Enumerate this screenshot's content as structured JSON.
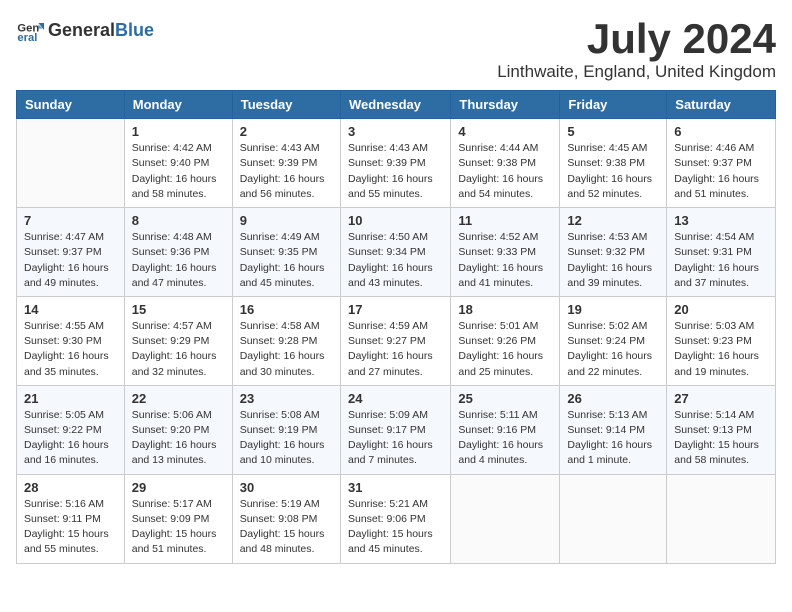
{
  "logo": {
    "text_general": "General",
    "text_blue": "Blue"
  },
  "title": {
    "month": "July 2024",
    "location": "Linthwaite, England, United Kingdom"
  },
  "days_of_week": [
    "Sunday",
    "Monday",
    "Tuesday",
    "Wednesday",
    "Thursday",
    "Friday",
    "Saturday"
  ],
  "weeks": [
    [
      {
        "day": "",
        "info": ""
      },
      {
        "day": "1",
        "info": "Sunrise: 4:42 AM\nSunset: 9:40 PM\nDaylight: 16 hours\nand 58 minutes."
      },
      {
        "day": "2",
        "info": "Sunrise: 4:43 AM\nSunset: 9:39 PM\nDaylight: 16 hours\nand 56 minutes."
      },
      {
        "day": "3",
        "info": "Sunrise: 4:43 AM\nSunset: 9:39 PM\nDaylight: 16 hours\nand 55 minutes."
      },
      {
        "day": "4",
        "info": "Sunrise: 4:44 AM\nSunset: 9:38 PM\nDaylight: 16 hours\nand 54 minutes."
      },
      {
        "day": "5",
        "info": "Sunrise: 4:45 AM\nSunset: 9:38 PM\nDaylight: 16 hours\nand 52 minutes."
      },
      {
        "day": "6",
        "info": "Sunrise: 4:46 AM\nSunset: 9:37 PM\nDaylight: 16 hours\nand 51 minutes."
      }
    ],
    [
      {
        "day": "7",
        "info": "Sunrise: 4:47 AM\nSunset: 9:37 PM\nDaylight: 16 hours\nand 49 minutes."
      },
      {
        "day": "8",
        "info": "Sunrise: 4:48 AM\nSunset: 9:36 PM\nDaylight: 16 hours\nand 47 minutes."
      },
      {
        "day": "9",
        "info": "Sunrise: 4:49 AM\nSunset: 9:35 PM\nDaylight: 16 hours\nand 45 minutes."
      },
      {
        "day": "10",
        "info": "Sunrise: 4:50 AM\nSunset: 9:34 PM\nDaylight: 16 hours\nand 43 minutes."
      },
      {
        "day": "11",
        "info": "Sunrise: 4:52 AM\nSunset: 9:33 PM\nDaylight: 16 hours\nand 41 minutes."
      },
      {
        "day": "12",
        "info": "Sunrise: 4:53 AM\nSunset: 9:32 PM\nDaylight: 16 hours\nand 39 minutes."
      },
      {
        "day": "13",
        "info": "Sunrise: 4:54 AM\nSunset: 9:31 PM\nDaylight: 16 hours\nand 37 minutes."
      }
    ],
    [
      {
        "day": "14",
        "info": "Sunrise: 4:55 AM\nSunset: 9:30 PM\nDaylight: 16 hours\nand 35 minutes."
      },
      {
        "day": "15",
        "info": "Sunrise: 4:57 AM\nSunset: 9:29 PM\nDaylight: 16 hours\nand 32 minutes."
      },
      {
        "day": "16",
        "info": "Sunrise: 4:58 AM\nSunset: 9:28 PM\nDaylight: 16 hours\nand 30 minutes."
      },
      {
        "day": "17",
        "info": "Sunrise: 4:59 AM\nSunset: 9:27 PM\nDaylight: 16 hours\nand 27 minutes."
      },
      {
        "day": "18",
        "info": "Sunrise: 5:01 AM\nSunset: 9:26 PM\nDaylight: 16 hours\nand 25 minutes."
      },
      {
        "day": "19",
        "info": "Sunrise: 5:02 AM\nSunset: 9:24 PM\nDaylight: 16 hours\nand 22 minutes."
      },
      {
        "day": "20",
        "info": "Sunrise: 5:03 AM\nSunset: 9:23 PM\nDaylight: 16 hours\nand 19 minutes."
      }
    ],
    [
      {
        "day": "21",
        "info": "Sunrise: 5:05 AM\nSunset: 9:22 PM\nDaylight: 16 hours\nand 16 minutes."
      },
      {
        "day": "22",
        "info": "Sunrise: 5:06 AM\nSunset: 9:20 PM\nDaylight: 16 hours\nand 13 minutes."
      },
      {
        "day": "23",
        "info": "Sunrise: 5:08 AM\nSunset: 9:19 PM\nDaylight: 16 hours\nand 10 minutes."
      },
      {
        "day": "24",
        "info": "Sunrise: 5:09 AM\nSunset: 9:17 PM\nDaylight: 16 hours\nand 7 minutes."
      },
      {
        "day": "25",
        "info": "Sunrise: 5:11 AM\nSunset: 9:16 PM\nDaylight: 16 hours\nand 4 minutes."
      },
      {
        "day": "26",
        "info": "Sunrise: 5:13 AM\nSunset: 9:14 PM\nDaylight: 16 hours\nand 1 minute."
      },
      {
        "day": "27",
        "info": "Sunrise: 5:14 AM\nSunset: 9:13 PM\nDaylight: 15 hours\nand 58 minutes."
      }
    ],
    [
      {
        "day": "28",
        "info": "Sunrise: 5:16 AM\nSunset: 9:11 PM\nDaylight: 15 hours\nand 55 minutes."
      },
      {
        "day": "29",
        "info": "Sunrise: 5:17 AM\nSunset: 9:09 PM\nDaylight: 15 hours\nand 51 minutes."
      },
      {
        "day": "30",
        "info": "Sunrise: 5:19 AM\nSunset: 9:08 PM\nDaylight: 15 hours\nand 48 minutes."
      },
      {
        "day": "31",
        "info": "Sunrise: 5:21 AM\nSunset: 9:06 PM\nDaylight: 15 hours\nand 45 minutes."
      },
      {
        "day": "",
        "info": ""
      },
      {
        "day": "",
        "info": ""
      },
      {
        "day": "",
        "info": ""
      }
    ]
  ]
}
